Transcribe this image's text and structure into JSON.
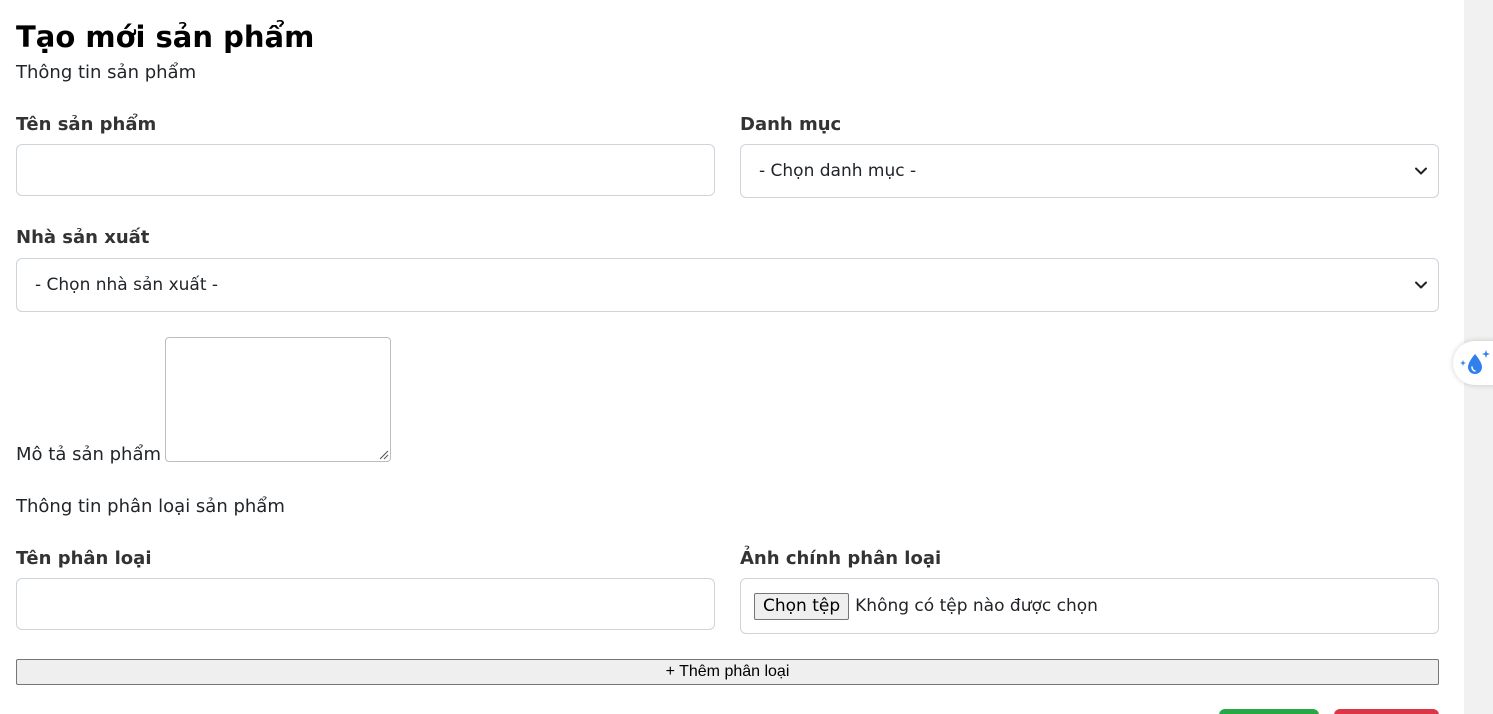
{
  "page": {
    "title": "Tạo mới sản phẩm",
    "subtitle": "Thông tin sản phẩm"
  },
  "product": {
    "name_label": "Tên sản phẩm",
    "name_value": "",
    "category_label": "Danh mục",
    "category_selected": "- Chọn danh mục -",
    "manufacturer_label": "Nhà sản xuất",
    "manufacturer_selected": "- Chọn nhà sản xuất -",
    "description_label": "Mô tả sản phẩm",
    "description_value": ""
  },
  "variant": {
    "section_title": "Thông tin phân loại sản phẩm",
    "name_label": "Tên phân loại",
    "name_value": "",
    "image_label": "Ảnh chính phân loại",
    "file_button_label": "Chọn tệp",
    "file_status": "Không có tệp nào được chọn",
    "add_button_label": "+ Thêm phân loại"
  },
  "icons": {
    "select_arrow": "chevron-down-icon",
    "floating_widget": "sparkle-drop-icon",
    "textarea_grip": "resize-grip-icon"
  },
  "colors": {
    "save_button": "#28a745",
    "cancel_button": "#dc3545",
    "widget_icon": "#2f80ed"
  }
}
